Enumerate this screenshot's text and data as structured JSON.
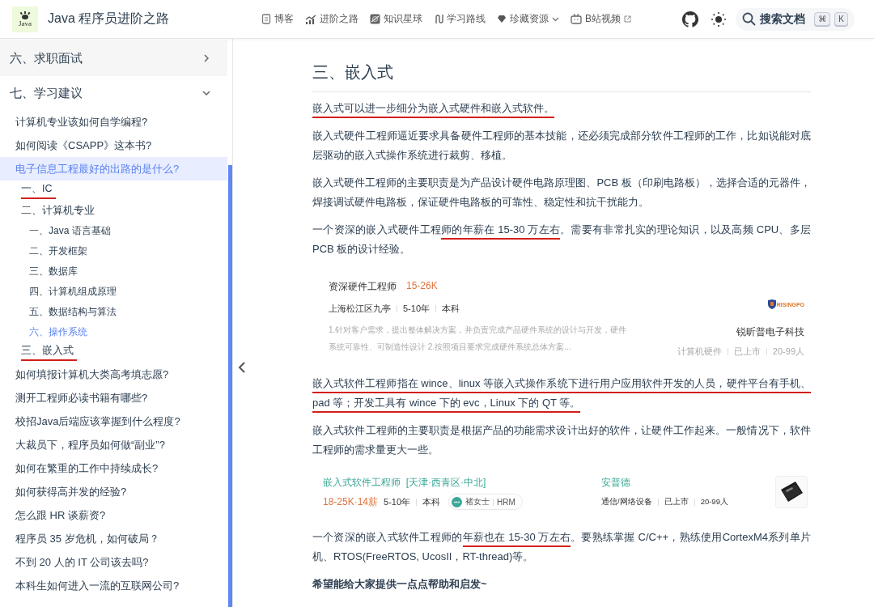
{
  "header": {
    "logo_text": "Java",
    "title": "Java 程序员进阶之路",
    "nav": [
      {
        "label": "博客",
        "kind": "doc",
        "dropdown": false,
        "external": false
      },
      {
        "label": "进阶之路",
        "kind": "chart",
        "dropdown": false,
        "external": false
      },
      {
        "label": "知识星球",
        "kind": "planet",
        "dropdown": false,
        "external": false
      },
      {
        "label": "学习路线",
        "kind": "route",
        "dropdown": false,
        "external": false
      },
      {
        "label": "珍藏资源",
        "kind": "gem",
        "dropdown": true,
        "external": false
      },
      {
        "label": "B站视频",
        "kind": "tv",
        "dropdown": false,
        "external": true
      }
    ],
    "search": {
      "placeholder": "搜索文档",
      "keys": [
        "⌘",
        "K"
      ]
    }
  },
  "sidebar": {
    "sections": [
      {
        "label": "六、求职面试",
        "expanded": false
      },
      {
        "label": "七、学习建议",
        "expanded": true,
        "items": [
          {
            "label": "计算机专业该如何自学编程?",
            "selected": false,
            "underlined": false
          },
          {
            "label": "如何阅读《CSAPP》这本书?",
            "selected": false,
            "underlined": false
          },
          {
            "label": "电子信息工程最好的出路的是什么?",
            "selected": true,
            "underlined": false,
            "children": [
              {
                "label": "一、IC",
                "active": false,
                "underlined": true
              },
              {
                "label": "二、计算机专业",
                "active": false,
                "underlined": false,
                "children": [
                  {
                    "label": "一、Java 语言基础",
                    "active": false,
                    "underlined": false
                  },
                  {
                    "label": "二、开发框架",
                    "active": false,
                    "underlined": false
                  },
                  {
                    "label": "三、数据库",
                    "active": false,
                    "underlined": false
                  },
                  {
                    "label": "四、计算机组成原理",
                    "active": false,
                    "underlined": false
                  },
                  {
                    "label": "五、数据结构与算法",
                    "active": false,
                    "underlined": false
                  },
                  {
                    "label": "六、操作系统",
                    "active": true,
                    "underlined": false
                  }
                ]
              },
              {
                "label": "三、嵌入式",
                "active": false,
                "underlined": true
              }
            ]
          },
          {
            "label": "如何填报计算机大类高考填志愿?",
            "selected": false,
            "underlined": false
          },
          {
            "label": "测开工程师必读书籍有哪些?",
            "selected": false,
            "underlined": false
          },
          {
            "label": "校招Java后端应该掌握到什么程度?",
            "selected": false,
            "underlined": false
          },
          {
            "label": "大裁员下，程序员如何做“副业”?",
            "selected": false,
            "underlined": false
          },
          {
            "label": "如何在繁重的工作中持续成长?",
            "selected": false,
            "underlined": false
          },
          {
            "label": "如何获得高并发的经验?",
            "selected": false,
            "underlined": false
          },
          {
            "label": "怎么跟 HR 谈薪资?",
            "selected": false,
            "underlined": false
          },
          {
            "label": "程序员 35 岁危机，如何破局？",
            "selected": false,
            "underlined": false
          },
          {
            "label": "不到 20 人的 IT 公司该去吗?",
            "selected": false,
            "underlined": false
          },
          {
            "label": "本科生如何进入一流的互联网公司?",
            "selected": false,
            "underlined": false
          }
        ]
      }
    ]
  },
  "article": {
    "heading": "三、嵌入式",
    "blocks": [
      {
        "kind": "paragraph",
        "segments": [
          {
            "text": "嵌入式可以进一步细分为嵌入式硬件和嵌入式软件。",
            "underlined": true
          }
        ]
      },
      {
        "kind": "paragraph",
        "segments": [
          {
            "text": "嵌入式硬件工程师逼近要求具备硬件工程师的基本技能，还必须完成部分软件工程师的工作，比如说能对底层驱动的嵌入式操作系统进行裁剪、移植。",
            "underlined": false
          }
        ]
      },
      {
        "kind": "paragraph",
        "segments": [
          {
            "text": "嵌入式硬件工程师的主要职责是为产品设计硬件电路原理图、PCB 板（印刷电路板），选择合适的元器件，焊接调试硬件电路板，保证硬件电路板的可靠性、稳定性和抗干扰能力。",
            "underlined": false
          }
        ]
      },
      {
        "kind": "paragraph",
        "segments": [
          {
            "text": "一个资深的嵌入式硬件工程",
            "underlined": false
          },
          {
            "text": "师的年薪在 15-30 万左右",
            "underlined": true
          },
          {
            "text": "。需要有非常扎实的理论知识，以及高频 CPU、多层 PCB 板的设计经验。",
            "underlined": false
          }
        ]
      },
      {
        "kind": "job_card",
        "title": "资深硬件工程师",
        "salary": "15-26K",
        "tags": [
          "上海松江区九亭",
          "5-10年",
          "本科"
        ],
        "description": "1.针对客户需求，提出整体解决方案，并负责完成产品硬件系统的设计与开发，硬件系统可靠性、可制造性设计 2.按照项目要求完成硬件系统总体方案...",
        "logo_text": "RISINGPO",
        "company": "锐昕普电子科技",
        "company_tags": [
          "计算机硬件",
          "已上市",
          "20-99人"
        ]
      },
      {
        "kind": "paragraph",
        "segments": [
          {
            "text": "嵌入式软件工程师指在 wince、linux 等嵌入式操作系统下进行用户应用软件开发的人员，硬件平台有手机、pad 等；开发工具有 wince 下的 evc，Linux 下的 QT 等。",
            "underlined": true
          }
        ]
      },
      {
        "kind": "paragraph",
        "segments": [
          {
            "text": "嵌入式软件工程师的主要职责是根据产品的功能需求设计出好的软件，让硬件工作起来。一般情况下，软件工程师的需求量更大一些。",
            "underlined": false
          }
        ]
      },
      {
        "kind": "job_row",
        "title": "嵌入式软件工程师",
        "location": "[天津·西青区·中北]",
        "salary": "18-25K·14薪",
        "tags": [
          "5-10年",
          "本科"
        ],
        "recruiter": {
          "name": "褚女士",
          "role": "HRM"
        },
        "company": "安普德",
        "company_tags": [
          "通信/网络设备",
          "已上市",
          "20-99人"
        ]
      },
      {
        "kind": "paragraph",
        "segments": [
          {
            "text": "一个资深的嵌入式软件工程师的",
            "underlined": false
          },
          {
            "text": "年薪也在 15-30 万左右",
            "underlined": true
          },
          {
            "text": "。要熟练掌握 C/C++，熟练使用CortexM4系列单片机、RTOS(FreeRTOS, UcosII，RT-thread)等。",
            "underlined": false
          }
        ]
      },
      {
        "kind": "bold",
        "segments": [
          {
            "text": "希望能给大家提供一点点帮助和启发~",
            "underlined": false
          }
        ]
      }
    ]
  }
}
